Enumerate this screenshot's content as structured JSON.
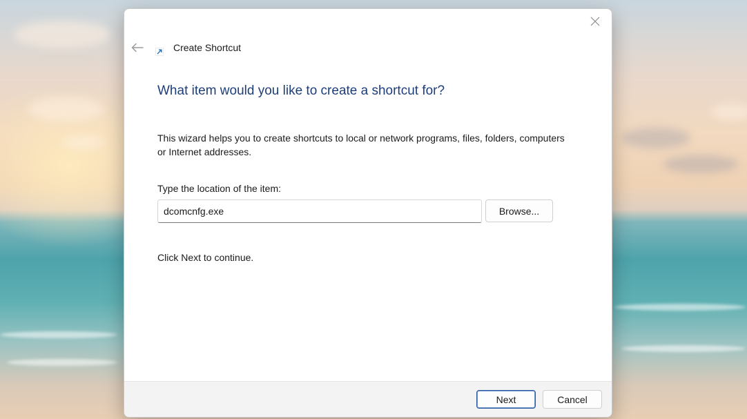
{
  "dialog": {
    "title": "Create Shortcut",
    "heading": "What item would you like to create a shortcut for?",
    "description": "This wizard helps you to create shortcuts to local or network programs, files, folders, computers or Internet addresses.",
    "location_label": "Type the location of the item:",
    "location_value": "dcomcnfg.exe",
    "browse_label": "Browse...",
    "continue_text": "Click Next to continue.",
    "icons": {
      "close": "close-icon",
      "back": "back-arrow-icon",
      "title": "shortcut-arrow-icon"
    }
  },
  "footer": {
    "next_label": "Next",
    "cancel_label": "Cancel"
  },
  "colors": {
    "heading": "#1e3d7b",
    "accent": "#2b5aa0",
    "footer_bg": "#f3f3f3"
  }
}
